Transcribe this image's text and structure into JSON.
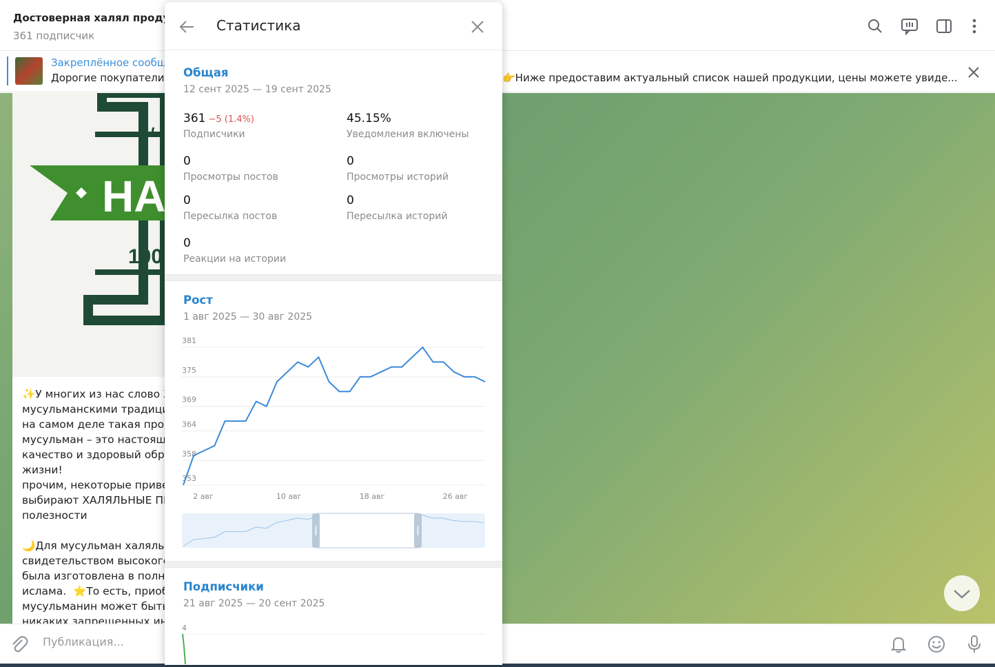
{
  "chat": {
    "title": "Достоверная халял продук",
    "subtitle": "361 подписчик",
    "pinned_title": "Закреплённое сообщ",
    "pinned_text_left": "Дорогие покупатели,",
    "pinned_text_right": "👉Ниже предоставим актуальный список нашей продукции, цены можете увиде...",
    "message_text": "✨У многих из нас слово Х\nмусульманскими традиция\nна самом деле такая проду\nмусульман – это настояща\nкачество и здоровый обра\nжизни!\nпрочим, некоторые приве\nвыбирают ХАЛЯЛЬНЫЕ ПР\nполезности\n\n🌙Для мусульман халяльн\nсвидетельством высокого \nбыла изготовлена в полно\nислама.  ⭐То есть, приоб\nмусульманин может быть у\nникаких запрещенных инг",
    "logo_letters": "HA",
    "logo_small": "100%",
    "composer_placeholder": "Публикация..."
  },
  "icons": {
    "header": [
      "search-icon",
      "live-stream-icon",
      "sidebar-toggle-icon",
      "more-vertical-icon"
    ],
    "composer": [
      "attach-icon",
      "bell-icon",
      "emoji-icon",
      "microphone-icon"
    ]
  },
  "modal": {
    "title": "Статистика",
    "overview": {
      "title": "Общая",
      "range": "12 сент 2025 — 19 сент 2025",
      "stats": [
        {
          "value": "361",
          "delta": "−5 (1.4%)",
          "label": "Подписчики"
        },
        {
          "value": "45.15%",
          "delta": "",
          "label": "Уведомления включены"
        },
        {
          "value": "0",
          "delta": "",
          "label": "Просмотры постов"
        },
        {
          "value": "0",
          "delta": "",
          "label": "Просмотры историй"
        },
        {
          "value": "0",
          "delta": "",
          "label": "Пересылка постов"
        },
        {
          "value": "0",
          "delta": "",
          "label": "Пересылка историй"
        },
        {
          "value": "0",
          "delta": "",
          "label": "Реакции на истории"
        }
      ]
    },
    "growth": {
      "title": "Рост",
      "range": "1 авг 2025 — 30 авг 2025"
    },
    "followers": {
      "title": "Подписчики",
      "range": "21 авг 2025 — 20 сент 2025",
      "first_tick": "4"
    }
  },
  "colors": {
    "accent": "#2a85cc",
    "line": "#3a8ad9",
    "negative": "#d9534f",
    "followers_line": "#4caf50"
  },
  "chart_data": [
    {
      "type": "line",
      "title": "Рост",
      "y_ticks": [
        353,
        358,
        364,
        369,
        375,
        381
      ],
      "x_tick_labels": [
        "2 авг",
        "10 авг",
        "18 авг",
        "26 авг"
      ],
      "x_tick_days": [
        2,
        10,
        18,
        26
      ],
      "ylim": [
        353,
        381
      ],
      "xlim": [
        1,
        30
      ],
      "grid": true,
      "series": [
        {
          "x": [
            1,
            2,
            3,
            4,
            5,
            6,
            7,
            8,
            9,
            10,
            11,
            12,
            13,
            14,
            15,
            16,
            17,
            18,
            19,
            20,
            21,
            22,
            23,
            24,
            25,
            26,
            27,
            28,
            29,
            30
          ],
          "values": [
            353,
            359,
            360,
            361,
            366,
            366,
            366,
            370,
            369,
            374,
            376,
            378,
            377,
            379,
            374,
            372,
            372,
            375,
            375,
            376,
            377,
            377,
            379,
            381,
            378,
            378,
            376,
            375,
            375,
            374
          ]
        }
      ]
    }
  ]
}
